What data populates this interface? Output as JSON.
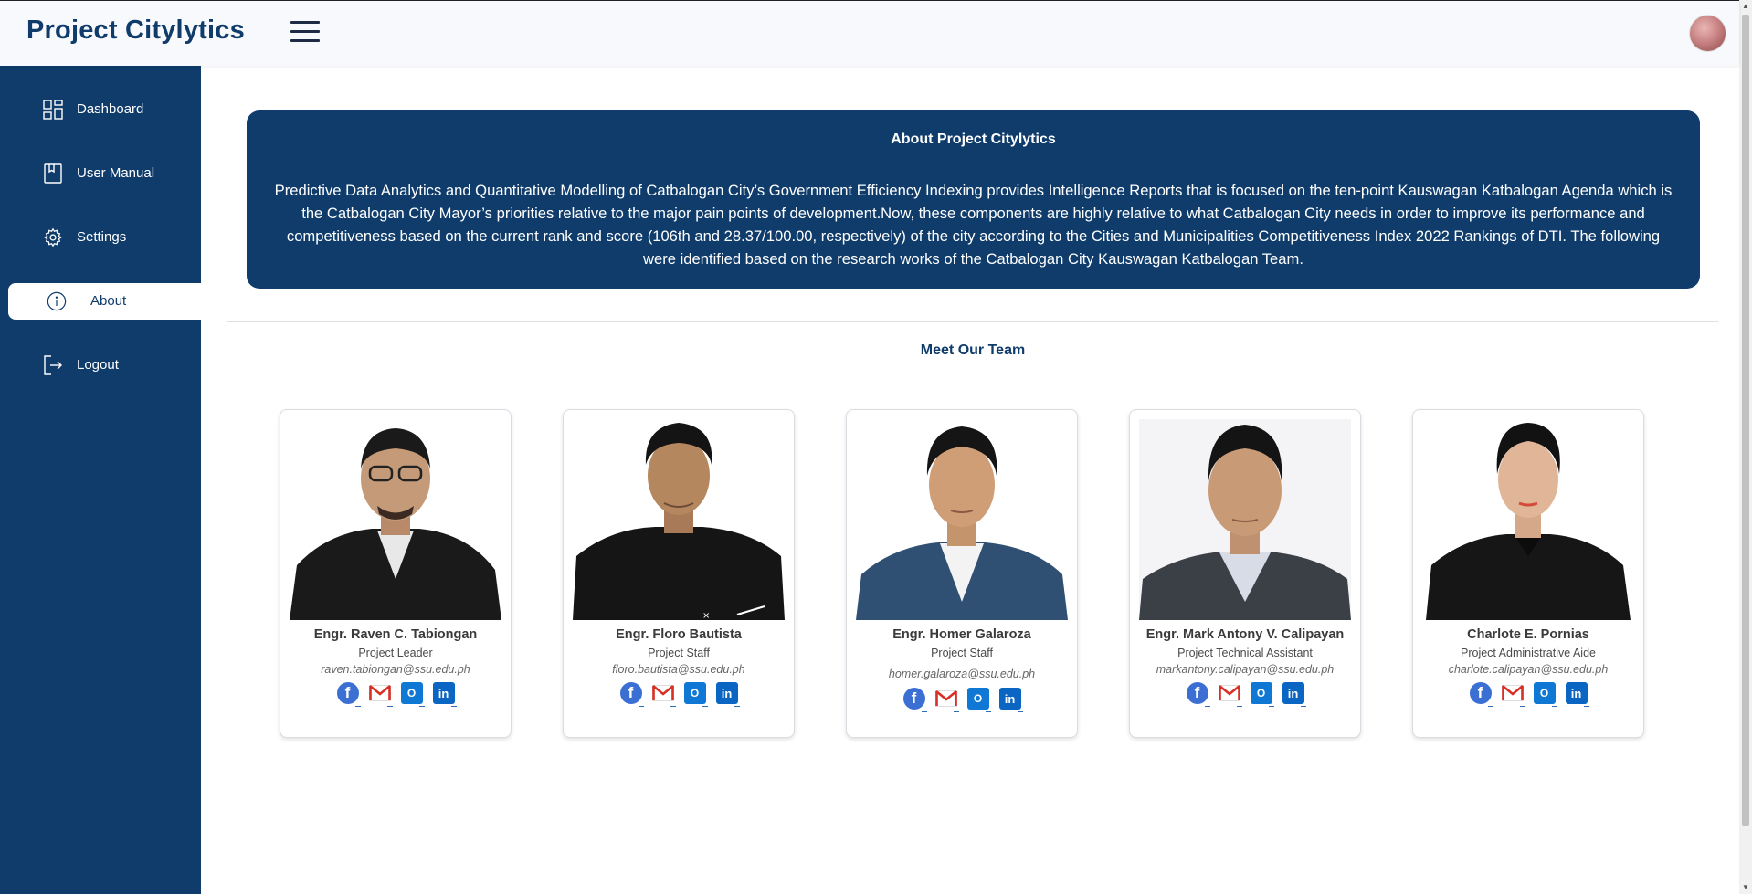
{
  "app": {
    "title": "Project Citylytics"
  },
  "sidebar": {
    "items": [
      {
        "label": "Dashboard",
        "icon": "dashboard-grid-icon"
      },
      {
        "label": "User Manual",
        "icon": "book-icon"
      },
      {
        "label": "Settings",
        "icon": "gear-icon"
      },
      {
        "label": "About",
        "icon": "info-icon",
        "active": true
      },
      {
        "label": "Logout",
        "icon": "logout-icon"
      }
    ]
  },
  "about": {
    "title": "About Project Citylytics",
    "body": "Predictive Data Analytics and Quantitative Modelling of Catbalogan City’s Government Efficiency Indexing provides Intelligence Reports that is focused on the ten-point Kauswagan Katbalogan Agenda which is the Catbalogan City Mayor’s priorities relative to the major pain points of development.Now, these components are highly relative to what Catbalogan City needs in order to improve its performance and competitiveness based on the current rank and score (106th and 28.37/100.00, respectively) of the city according to the Cities and Municipalities Competitiveness Index 2022 Rankings of DTI. The following were identified based on the research works of the Catbalogan City Kauswagan Katbalogan Team."
  },
  "team": {
    "title": "Meet Our Team",
    "members": [
      {
        "name": "Engr. Raven C. Tabiongan",
        "role": "Project Leader",
        "email": "raven.tabiongan@ssu.edu.ph"
      },
      {
        "name": "Engr. Floro Bautista",
        "role": "Project Staff",
        "email": "floro.bautista@ssu.edu.ph"
      },
      {
        "name": "Engr. Homer Galaroza",
        "role": "Project Staff",
        "email": "homer.galaroza@ssu.edu.ph"
      },
      {
        "name": "Engr. Mark Antony V. Calipayan",
        "role": "Project Technical Assistant",
        "email": "markantony.calipayan@ssu.edu.ph"
      },
      {
        "name": "Charlote E. Pornias",
        "role": "Project Administrative Aide",
        "email": "charlote.calipayan@ssu.edu.ph"
      }
    ]
  },
  "colors": {
    "primary": "#0f3c6b",
    "background": "#ffffff"
  }
}
